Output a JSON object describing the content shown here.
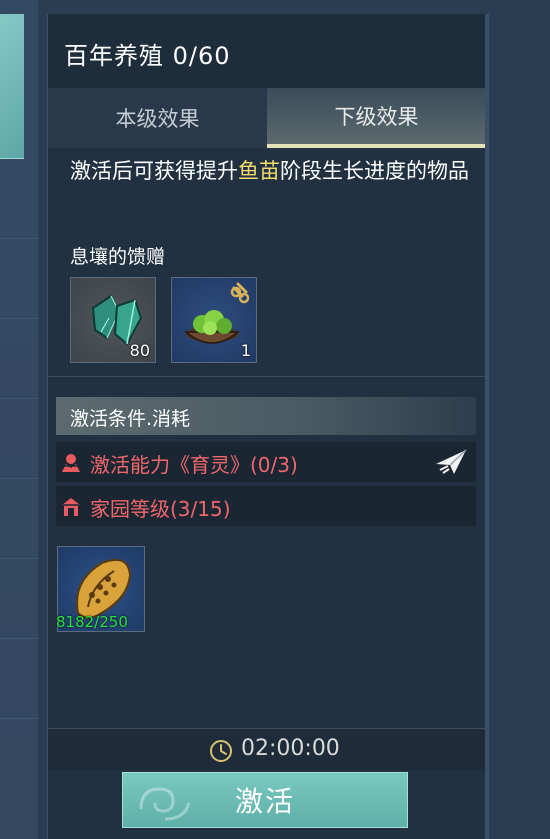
{
  "panel": {
    "title": "百年养殖 0/60",
    "tabs": [
      {
        "label": "本级效果",
        "active": false
      },
      {
        "label": "下级效果",
        "active": true
      }
    ],
    "description": {
      "before": "激活后可获得提升",
      "highlight": "鱼苗",
      "after": "阶段生长进度的物品"
    },
    "reward_label": "息壤的馈赠",
    "rewards": [
      {
        "icon": "green-crystal-icon",
        "count": "80"
      },
      {
        "icon": "fish-fry-bowl-icon",
        "count": "1"
      }
    ],
    "conditions_header": "激活条件.消耗",
    "conditions": [
      {
        "icon": "ability-icon",
        "text": "激活能力《育灵》(0/3)"
      },
      {
        "icon": "home-icon",
        "text": "家园等级(3/15)"
      }
    ],
    "cost_item": {
      "icon": "golden-shell-icon",
      "count": "8182/250"
    },
    "timer": "02:00:00",
    "activate_label": "激活"
  },
  "colors": {
    "highlight": "#f4dc6e",
    "condition_text": "#f0676b",
    "cost_count": "#26e13f",
    "tab_active_underline": "#e6e2b9",
    "button": "#6fbfb8"
  }
}
